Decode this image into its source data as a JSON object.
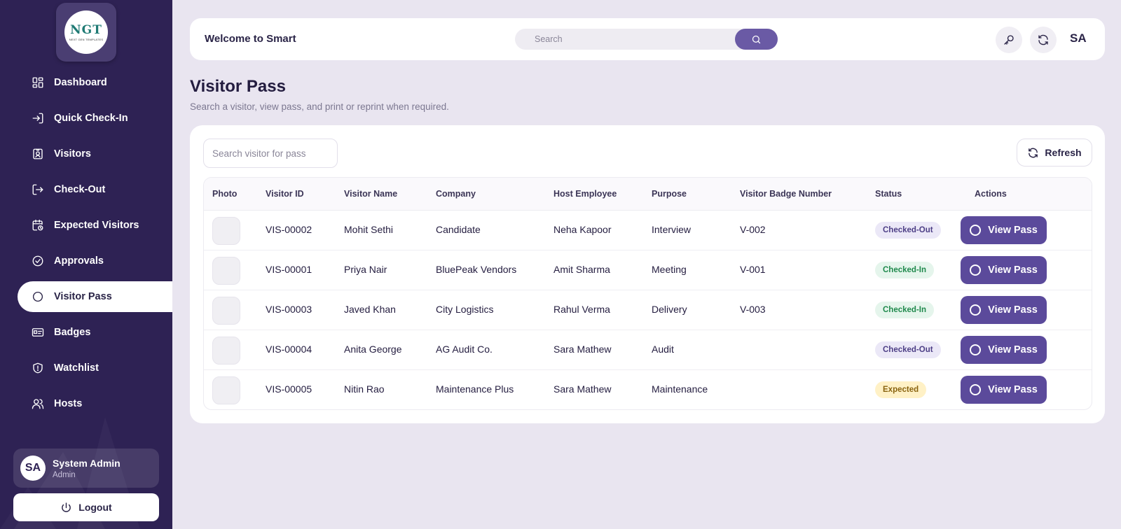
{
  "app": {
    "logo_text": "NGT",
    "logo_subtext": "NEXT GEN TEMPLATES"
  },
  "sidebar": {
    "items": [
      {
        "label": "Dashboard",
        "icon": "dashboard-icon"
      },
      {
        "label": "Quick Check-In",
        "icon": "login-arrow-icon"
      },
      {
        "label": "Visitors",
        "icon": "id-badge-icon"
      },
      {
        "label": "Check-Out",
        "icon": "logout-arrow-icon"
      },
      {
        "label": "Expected Visitors",
        "icon": "calendar-clock-icon"
      },
      {
        "label": "Approvals",
        "icon": "check-circle-icon"
      },
      {
        "label": "Visitor Pass",
        "icon": "circle-icon",
        "active": true
      },
      {
        "label": "Badges",
        "icon": "id-card-icon"
      },
      {
        "label": "Watchlist",
        "icon": "shield-icon"
      },
      {
        "label": "Hosts",
        "icon": "users-icon"
      }
    ],
    "user": {
      "initials": "SA",
      "name": "System Admin",
      "role": "Admin"
    },
    "logout_label": "Logout"
  },
  "topbar": {
    "welcome": "Welcome to Smart",
    "search_placeholder": "Search",
    "initials": "SA"
  },
  "page": {
    "title": "Visitor Pass",
    "subtitle": "Search a visitor, view pass, and print or reprint when required."
  },
  "filters": {
    "search_placeholder": "Search visitor for pass",
    "refresh_label": "Refresh"
  },
  "table": {
    "columns": [
      "Photo",
      "Visitor ID",
      "Visitor Name",
      "Company",
      "Host Employee",
      "Purpose",
      "Visitor Badge Number",
      "Status",
      "Actions"
    ],
    "rows": [
      {
        "id": "VIS-00002",
        "name": "Mohit Sethi",
        "company": "Candidate",
        "host": "Neha Kapoor",
        "purpose": "Interview",
        "badge": "V-002",
        "status": "Checked-Out",
        "action": "View Pass"
      },
      {
        "id": "VIS-00001",
        "name": "Priya Nair",
        "company": "BluePeak Vendors",
        "host": "Amit Sharma",
        "purpose": "Meeting",
        "badge": "V-001",
        "status": "Checked-In",
        "action": "View Pass"
      },
      {
        "id": "VIS-00003",
        "name": "Javed Khan",
        "company": "City Logistics",
        "host": "Rahul Verma",
        "purpose": "Delivery",
        "badge": "V-003",
        "status": "Checked-In",
        "action": "View Pass"
      },
      {
        "id": "VIS-00004",
        "name": "Anita George",
        "company": "AG Audit Co.",
        "host": "Sara Mathew",
        "purpose": "Audit",
        "badge": "",
        "status": "Checked-Out",
        "action": "View Pass"
      },
      {
        "id": "VIS-00005",
        "name": "Nitin Rao",
        "company": "Maintenance Plus",
        "host": "Sara Mathew",
        "purpose": "Maintenance",
        "badge": "",
        "status": "Expected",
        "action": "View Pass"
      }
    ]
  },
  "colors": {
    "sidebar_bg": "#2e2254",
    "accent": "#5b4a9b",
    "page_bg": "#e9e5f0",
    "status_checked_out": "#4d3f86",
    "status_checked_in": "#208a4d",
    "status_expected": "#8a6410"
  }
}
